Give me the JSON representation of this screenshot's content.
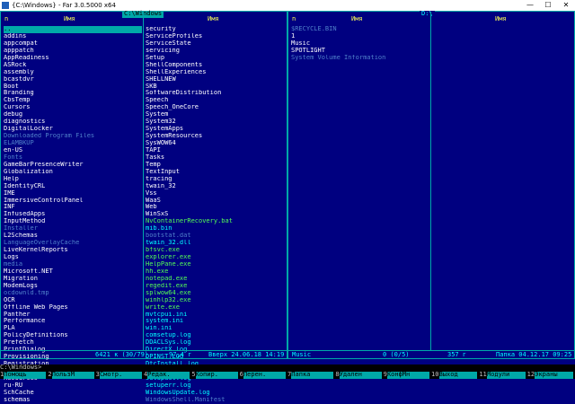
{
  "window": {
    "title": "{C:\\Windows} - Far 3.0.5000 x64",
    "min_glyph": "—",
    "max_glyph": "☐",
    "close_glyph": "✕"
  },
  "clock": "",
  "left_panel": {
    "path": " C:\\Windows ",
    "col_left_header": "n",
    "col1_header": "Имя",
    "col2_header": "Имя",
    "col1": [
      {
        "name": "..",
        "kind": "cur"
      },
      {
        "name": "addins",
        "kind": "dir"
      },
      {
        "name": "appcompat",
        "kind": "dir"
      },
      {
        "name": "apppatch",
        "kind": "dir"
      },
      {
        "name": "AppReadiness",
        "kind": "dir"
      },
      {
        "name": "ASRock",
        "kind": "dir"
      },
      {
        "name": "assembly",
        "kind": "dir"
      },
      {
        "name": "bcastdvr",
        "kind": "dir"
      },
      {
        "name": "Boot",
        "kind": "dir"
      },
      {
        "name": "Branding",
        "kind": "dir"
      },
      {
        "name": "CbsTemp",
        "kind": "dir"
      },
      {
        "name": "Cursors",
        "kind": "dir"
      },
      {
        "name": "debug",
        "kind": "dir"
      },
      {
        "name": "diagnostics",
        "kind": "dir"
      },
      {
        "name": "DigitalLocker",
        "kind": "dir"
      },
      {
        "name": "Downloaded Program Files",
        "kind": "hid"
      },
      {
        "name": "ELAMBKUP",
        "kind": "hid"
      },
      {
        "name": "en-US",
        "kind": "dir"
      },
      {
        "name": "Fonts",
        "kind": "hid"
      },
      {
        "name": "GameBarPresenceWriter",
        "kind": "dir"
      },
      {
        "name": "Globalization",
        "kind": "dir"
      },
      {
        "name": "Help",
        "kind": "dir"
      },
      {
        "name": "IdentityCRL",
        "kind": "dir"
      },
      {
        "name": "IME",
        "kind": "dir"
      },
      {
        "name": "ImmersiveControlPanel",
        "kind": "dir"
      },
      {
        "name": "INF",
        "kind": "dir"
      },
      {
        "name": "InfusedApps",
        "kind": "dir"
      },
      {
        "name": "InputMethod",
        "kind": "dir"
      },
      {
        "name": "Installer",
        "kind": "hid"
      },
      {
        "name": "L2Schemas",
        "kind": "dir"
      },
      {
        "name": "LanguageOverlayCache",
        "kind": "hid"
      },
      {
        "name": "LiveKernelReports",
        "kind": "dir"
      },
      {
        "name": "Logs",
        "kind": "dir"
      },
      {
        "name": "media",
        "kind": "hid"
      },
      {
        "name": "Microsoft.NET",
        "kind": "dir"
      },
      {
        "name": "Migration",
        "kind": "dir"
      },
      {
        "name": "ModemLogs",
        "kind": "dir"
      },
      {
        "name": "ocdownld.tmp",
        "kind": "hid"
      },
      {
        "name": "OCR",
        "kind": "dir"
      },
      {
        "name": "Offline Web Pages",
        "kind": "dir"
      },
      {
        "name": "Panther",
        "kind": "dir"
      },
      {
        "name": "Performance",
        "kind": "dir"
      },
      {
        "name": "PLA",
        "kind": "dir"
      },
      {
        "name": "PolicyDefinitions",
        "kind": "dir"
      },
      {
        "name": "Prefetch",
        "kind": "dir"
      },
      {
        "name": "PrintDialog",
        "kind": "dir"
      },
      {
        "name": "Provisioning",
        "kind": "dir"
      },
      {
        "name": "Registration",
        "kind": "dir"
      },
      {
        "name": "rescache",
        "kind": "dir"
      },
      {
        "name": "Resources",
        "kind": "dir"
      },
      {
        "name": "ru-RU",
        "kind": "dir"
      },
      {
        "name": "SchCache",
        "kind": "dir"
      },
      {
        "name": "schemas",
        "kind": "dir"
      }
    ],
    "col2": [
      {
        "name": "security",
        "kind": "dir"
      },
      {
        "name": "ServiceProfiles",
        "kind": "dir"
      },
      {
        "name": "ServiceState",
        "kind": "dir"
      },
      {
        "name": "servicing",
        "kind": "dir"
      },
      {
        "name": "Setup",
        "kind": "dir"
      },
      {
        "name": "ShellComponents",
        "kind": "dir"
      },
      {
        "name": "ShellExperiences",
        "kind": "dir"
      },
      {
        "name": "SHELLNEW",
        "kind": "dir"
      },
      {
        "name": "SKB",
        "kind": "dir"
      },
      {
        "name": "SoftwareDistribution",
        "kind": "dir"
      },
      {
        "name": "Speech",
        "kind": "dir"
      },
      {
        "name": "Speech_OneCore",
        "kind": "dir"
      },
      {
        "name": "System",
        "kind": "dir"
      },
      {
        "name": "System32",
        "kind": "dir"
      },
      {
        "name": "SystemApps",
        "kind": "dir"
      },
      {
        "name": "SystemResources",
        "kind": "dir"
      },
      {
        "name": "SysWOW64",
        "kind": "dir"
      },
      {
        "name": "TAPI",
        "kind": "dir"
      },
      {
        "name": "Tasks",
        "kind": "dir"
      },
      {
        "name": "Temp",
        "kind": "dir"
      },
      {
        "name": "TextInput",
        "kind": "dir"
      },
      {
        "name": "tracing",
        "kind": "dir"
      },
      {
        "name": "twain_32",
        "kind": "dir"
      },
      {
        "name": "Vss",
        "kind": "dir"
      },
      {
        "name": "WaaS",
        "kind": "dir"
      },
      {
        "name": "Web",
        "kind": "dir"
      },
      {
        "name": "WinSxS",
        "kind": "dir"
      },
      {
        "name": "NvContainerRecovery.bat",
        "kind": "exe"
      },
      {
        "name": "mib.bin",
        "kind": "file"
      },
      {
        "name": "bootstat.dat",
        "kind": "hid"
      },
      {
        "name": "twain_32.dll",
        "kind": "file"
      },
      {
        "name": "bfsvc.exe",
        "kind": "exe"
      },
      {
        "name": "explorer.exe",
        "kind": "exe"
      },
      {
        "name": "HelpPane.exe",
        "kind": "exe"
      },
      {
        "name": "hh.exe",
        "kind": "exe"
      },
      {
        "name": "notepad.exe",
        "kind": "exe"
      },
      {
        "name": "regedit.exe",
        "kind": "exe"
      },
      {
        "name": "splwow64.exe",
        "kind": "exe"
      },
      {
        "name": "winhlp32.exe",
        "kind": "exe"
      },
      {
        "name": "write.exe",
        "kind": "exe"
      },
      {
        "name": "mvtcpui.ini",
        "kind": "file"
      },
      {
        "name": "system.ini",
        "kind": "file"
      },
      {
        "name": "win.ini",
        "kind": "file"
      },
      {
        "name": "comsetup.log",
        "kind": "file"
      },
      {
        "name": "DDACLSys.log",
        "kind": "file"
      },
      {
        "name": "DirectX.log",
        "kind": "file"
      },
      {
        "name": "DPINST.LOG",
        "kind": "file"
      },
      {
        "name": "DtcInstall.log",
        "kind": "file"
      },
      {
        "name": "PFRO.log",
        "kind": "file"
      },
      {
        "name": "setupact.log",
        "kind": "file"
      },
      {
        "name": "setuperr.log",
        "kind": "file"
      },
      {
        "name": "WindowsUpdate.log",
        "kind": "file"
      },
      {
        "name": "WindowsShell.Manifest",
        "kind": "hid"
      }
    ],
    "status_name": "..",
    "status_mid": "6421 к (30/79)",
    "status_size": "97,4 г",
    "status_date": "Вверх 24.06.18 14:19"
  },
  "right_panel": {
    "path": " D:\\ ",
    "col_left_header": "n",
    "col1_header": "Имя",
    "col2_header": "Имя",
    "col1": [
      {
        "name": "$RECYCLE.BIN",
        "kind": "hid"
      },
      {
        "name": "1",
        "kind": "dir"
      },
      {
        "name": "Music",
        "kind": "dir"
      },
      {
        "name": "SPOTLIGHT",
        "kind": "dir"
      },
      {
        "name": "System Volume Information",
        "kind": "hid"
      }
    ],
    "status_name": "Music",
    "status_mid": "0 (0/5)",
    "status_size": "357 г",
    "status_date": "Папка 04.12.17 09:25"
  },
  "cmdline": {
    "prompt": "C:\\Windows>"
  },
  "keybar": [
    {
      "num": "1",
      "label": "Помощь"
    },
    {
      "num": "2",
      "label": "ПользМ"
    },
    {
      "num": "3",
      "label": "Смотр."
    },
    {
      "num": "4",
      "label": "Редак."
    },
    {
      "num": "5",
      "label": "Копир."
    },
    {
      "num": "6",
      "label": "Перен."
    },
    {
      "num": "7",
      "label": "Папка"
    },
    {
      "num": "8",
      "label": "Удален"
    },
    {
      "num": "9",
      "label": "КонфМн"
    },
    {
      "num": "10",
      "label": "Выход"
    },
    {
      "num": "11",
      "label": "Модули"
    },
    {
      "num": "12",
      "label": "Экраны"
    }
  ],
  "colors": {
    "panel_bg": "#000080",
    "border": "#00a8a8",
    "dir": "#ffffff",
    "file": "#00ffff",
    "hidden": "#4f80c9",
    "exe": "#55ff55",
    "header": "#ffff55"
  }
}
